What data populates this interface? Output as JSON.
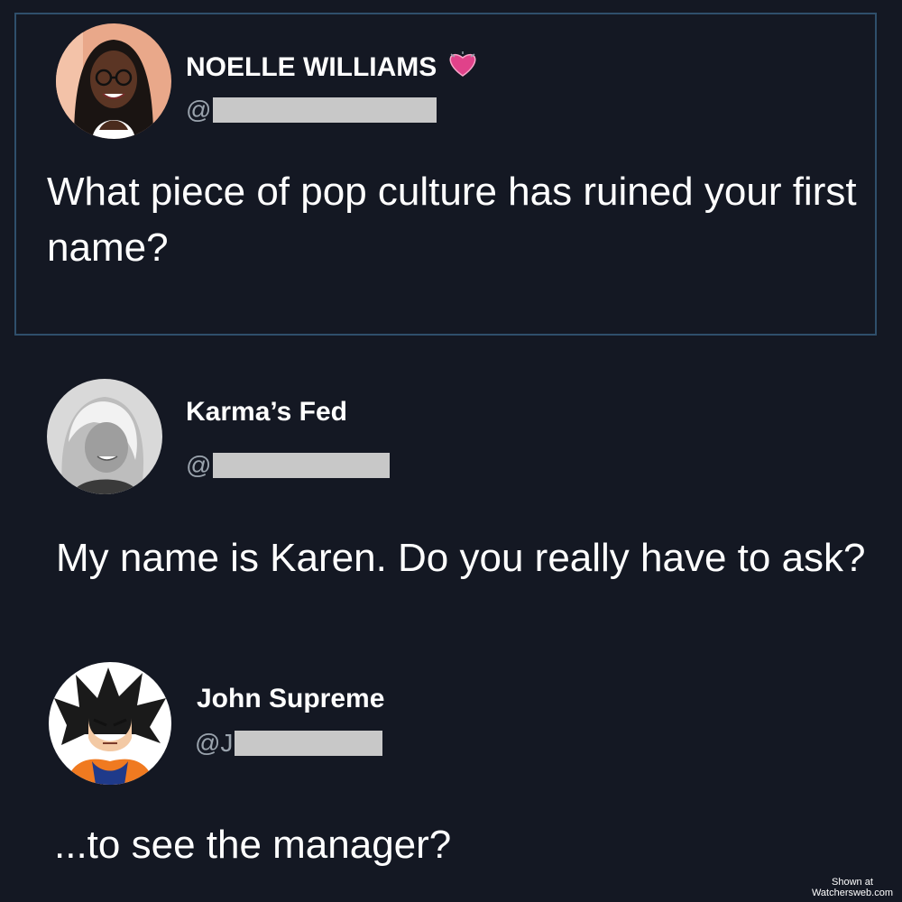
{
  "tweets": [
    {
      "name": "NOELLE WILLIAMS",
      "handle_prefix": "@",
      "text": "What piece of pop culture has ruined your first name?",
      "badge_icon": "growing-heart-emoji"
    },
    {
      "name": "Karma’s Fed",
      "handle_prefix": "@",
      "text": "My name is Karen. Do you really have to ask?"
    },
    {
      "name": "John Supreme",
      "handle_prefix": "@J",
      "text": "...to see the manager?"
    }
  ],
  "watermark": {
    "line1": "Shown at",
    "line2": "Watchersweb.com"
  },
  "colors": {
    "background": "#141823",
    "quote_border": "#2f4f6b",
    "handle_gray": "#9aa3ad",
    "redaction": "#c8c8c8",
    "heart": "#e0428a"
  }
}
